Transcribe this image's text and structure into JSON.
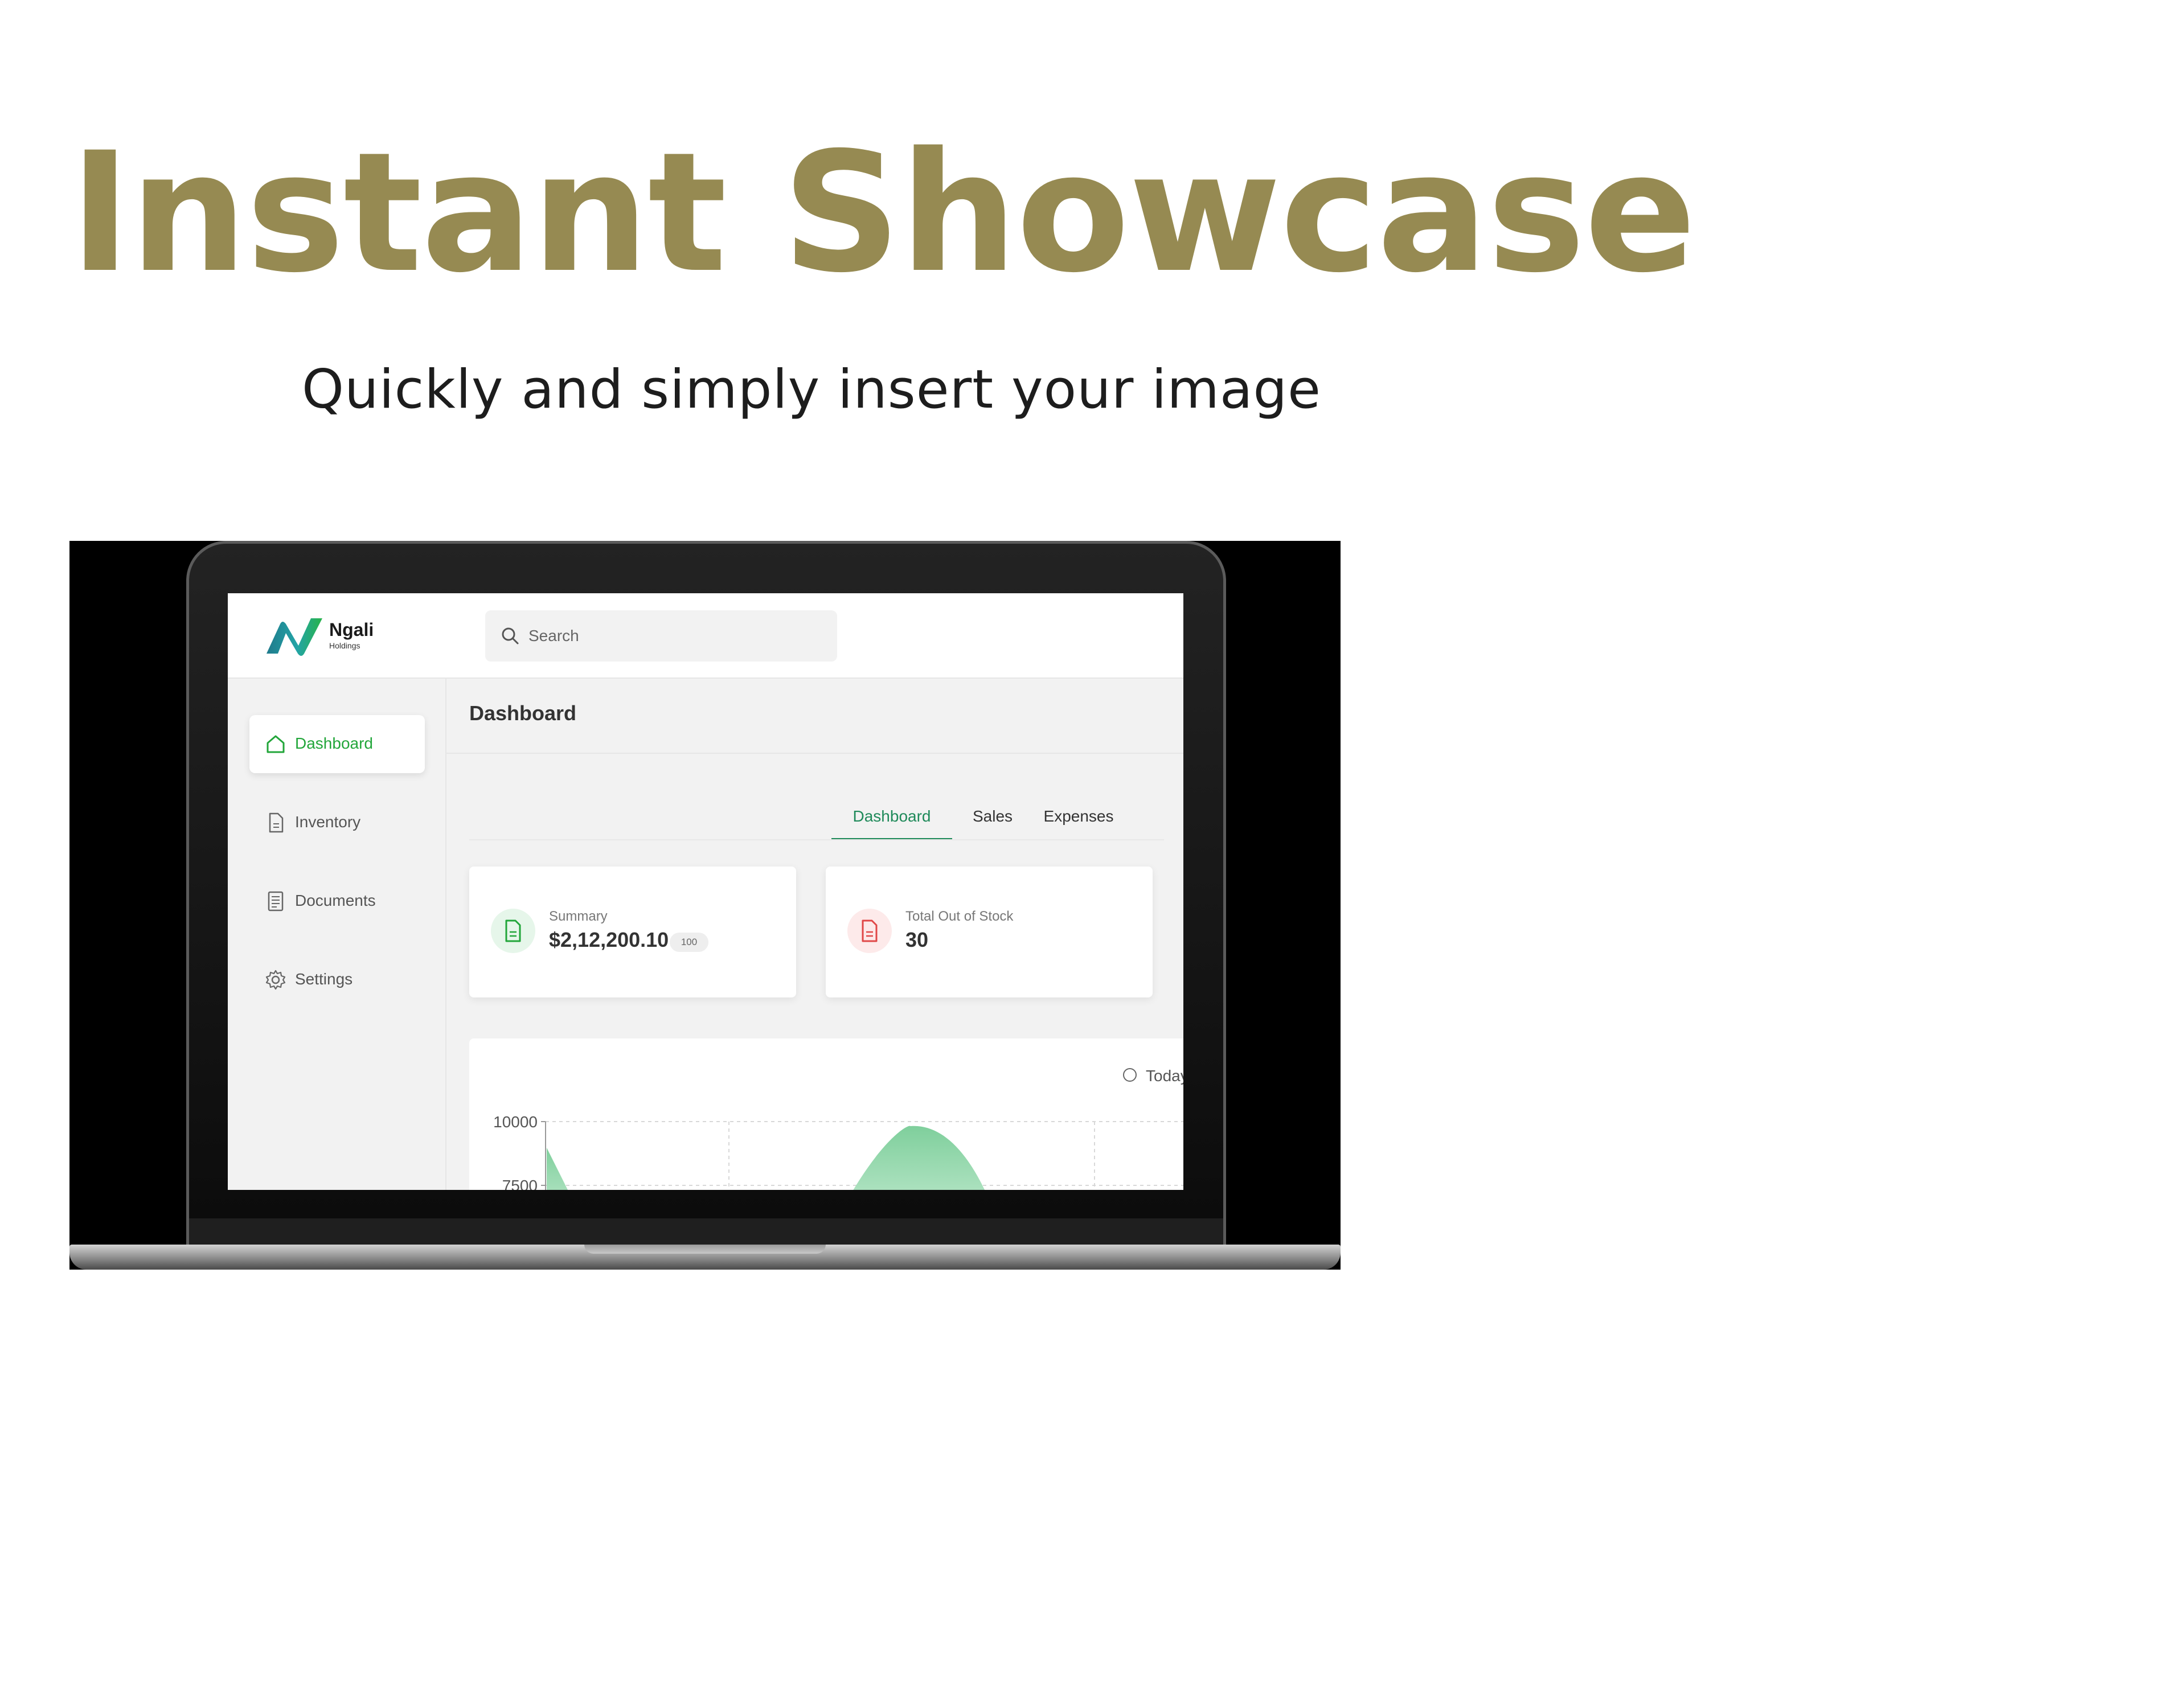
{
  "slide": {
    "title": "Instant Showcase",
    "subtitle": "Quickly and simply insert your image"
  },
  "app": {
    "logo": {
      "name": "Ngali",
      "subname": "Holdings"
    },
    "search": {
      "placeholder": "Search"
    },
    "sidebar": {
      "items": [
        {
          "label": "Dashboard",
          "icon": "home-icon",
          "active": true
        },
        {
          "label": "Inventory",
          "icon": "file-icon",
          "active": false
        },
        {
          "label": "Documents",
          "icon": "document-icon",
          "active": false
        },
        {
          "label": "Settings",
          "icon": "gear-icon",
          "active": false
        }
      ]
    },
    "page_title": "Dashboard",
    "tabs": [
      {
        "label": "Dashboard",
        "active": true
      },
      {
        "label": "Sales",
        "active": false
      },
      {
        "label": "Expenses",
        "active": false
      }
    ],
    "cards": [
      {
        "label": "Summary",
        "value": "$2,12,200.10",
        "badge": "100",
        "icon": "file-icon",
        "accent": "#22a63a"
      },
      {
        "label": "Total Out of Stock",
        "value": "30",
        "icon": "file-icon",
        "accent": "#e04848"
      }
    ],
    "chart_filter": {
      "label": "Today",
      "selected": false
    }
  },
  "chart_data": {
    "type": "area",
    "yticks": [
      "10000",
      "7500"
    ],
    "color": "#7fcf9c"
  },
  "colors": {
    "title": "#968a52",
    "accent_green": "#22a63a",
    "tab_active": "#1f8a5a"
  }
}
